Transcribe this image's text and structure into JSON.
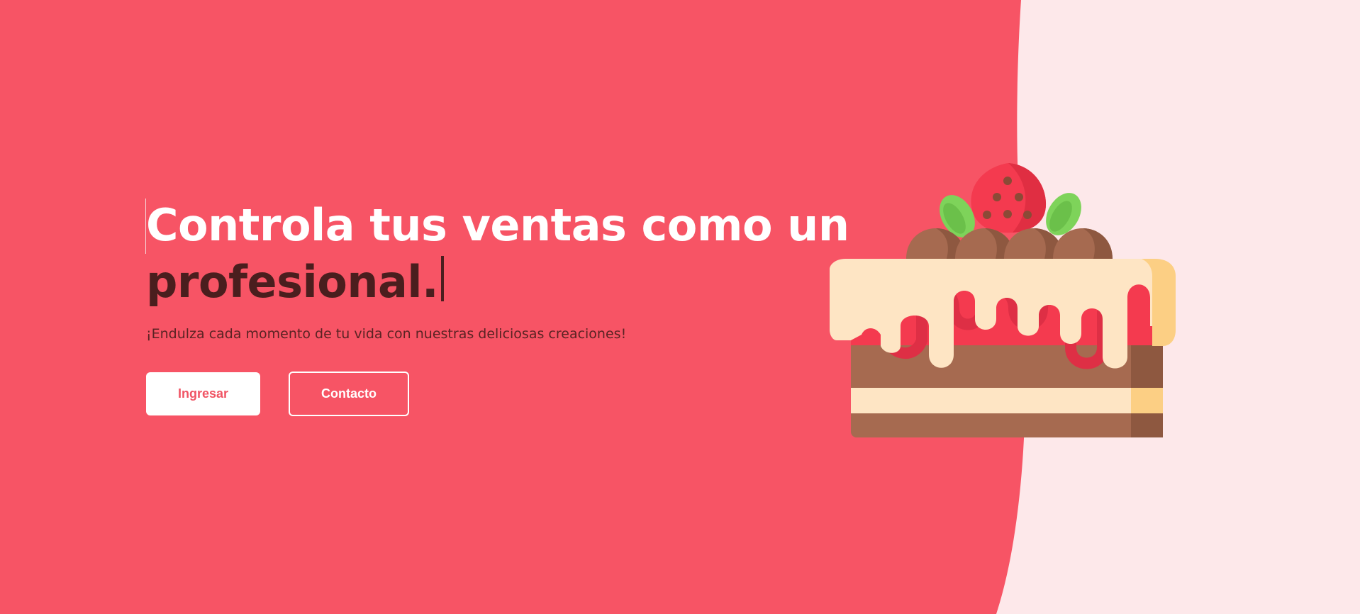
{
  "hero": {
    "title_line1": "Controla tus ventas como un",
    "title_line2": "profesional.",
    "subtitle": "¡Endulza cada momento de tu vida con nuestras deliciosas creaciones!"
  },
  "actions": {
    "login_label": "Ingresar",
    "contact_label": "Contacto"
  },
  "illustration": {
    "icon": "cake-icon"
  },
  "colors": {
    "primary_bg": "#F75465",
    "secondary_bg": "#FDE8EA",
    "title_light": "#FFFFFF",
    "title_dark": "#4A1E1E",
    "button_text": "#F05464"
  }
}
